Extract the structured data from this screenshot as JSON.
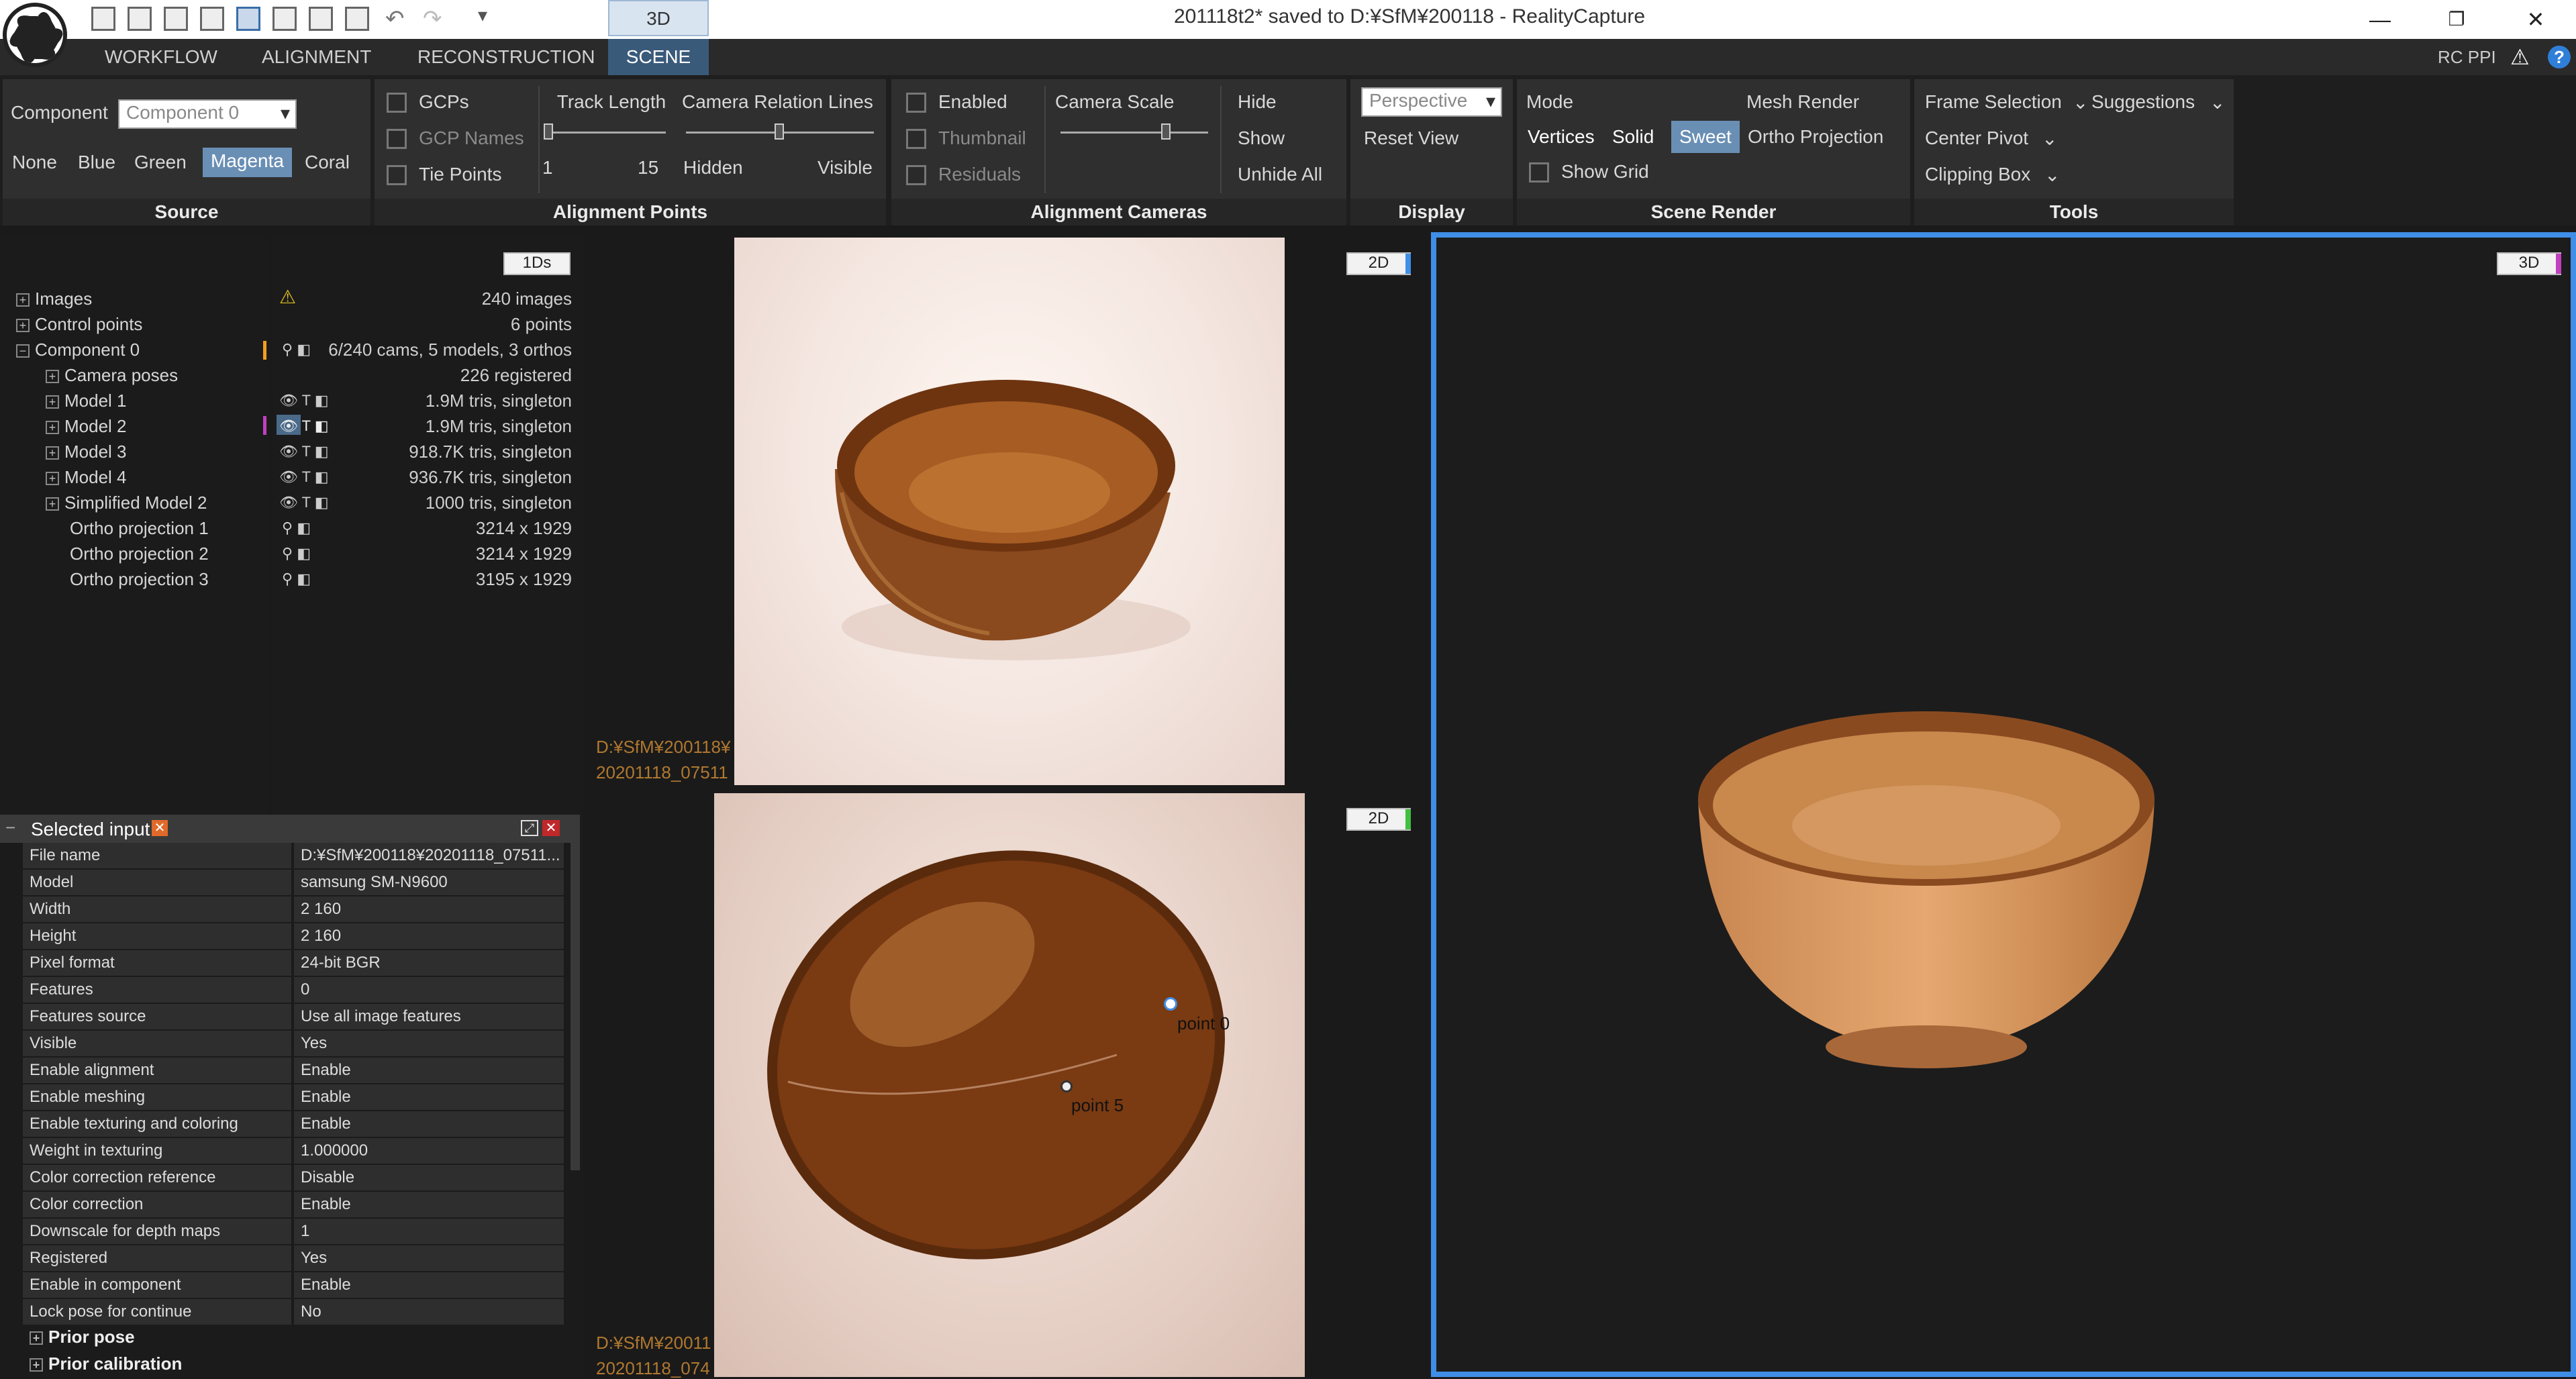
{
  "titlebar": {
    "view_tab": "3D",
    "title": "201118t2* saved to D:¥SfM¥200118 - RealityCapture",
    "minimize": "—",
    "restore": "❐",
    "close": "✕"
  },
  "menu": {
    "tabs": [
      "WORKFLOW",
      "ALIGNMENT",
      "RECONSTRUCTION",
      "SCENE"
    ],
    "right_label": "RC PPI"
  },
  "ribbon": {
    "source": {
      "component_label": "Component",
      "component_value": "Component 0",
      "colors": [
        "None",
        "Blue",
        "Green",
        "Magenta",
        "Coral"
      ],
      "footer": "Source"
    },
    "alignment_points": {
      "gcps": "GCPs",
      "gcp_names": "GCP Names",
      "tie_points": "Tie Points",
      "track_length": "Track Length",
      "track_min": "1",
      "track_max": "15",
      "camera_relation_lines": "Camera Relation Lines",
      "hidden": "Hidden",
      "visible": "Visible",
      "footer": "Alignment Points"
    },
    "alignment_cameras": {
      "enabled": "Enabled",
      "thumbnail": "Thumbnail",
      "residuals": "Residuals",
      "camera_scale": "Camera Scale",
      "hide": "Hide",
      "show": "Show",
      "unhide_all": "Unhide All",
      "footer": "Alignment Cameras"
    },
    "display": {
      "projection": "Perspective",
      "reset_view": "Reset View",
      "footer": "Display"
    },
    "scene_render": {
      "mode": "Mode",
      "mesh_render": "Mesh Render",
      "vertices": "Vertices",
      "solid": "Solid",
      "sweet": "Sweet",
      "ortho_projection": "Ortho Projection",
      "show_grid": "Show Grid",
      "footer": "Scene Render"
    },
    "tools": {
      "frame_selection": "Frame Selection",
      "suggestions": "Suggestions",
      "center_pivot": "Center Pivot",
      "clipping_box": "Clipping Box",
      "footer": "Tools"
    }
  },
  "tree": {
    "badge": "1Ds",
    "rows": [
      {
        "label": "Images",
        "value": "240 images"
      },
      {
        "label": "Control points",
        "value": "6 points"
      },
      {
        "label": "Component 0",
        "value": "6/240 cams, 5 models, 3 orthos"
      },
      {
        "label": "Camera poses",
        "value": "226 registered"
      },
      {
        "label": "Model 1",
        "value": "1.9M tris, singleton"
      },
      {
        "label": "Model 2",
        "value": "1.9M tris, singleton"
      },
      {
        "label": "Model 3",
        "value": "918.7K tris, singleton"
      },
      {
        "label": "Model 4",
        "value": "936.7K tris, singleton"
      },
      {
        "label": "Simplified Model 2",
        "value": "1000 tris, singleton"
      },
      {
        "label": "Ortho projection 1",
        "value": "3214 x 1929"
      },
      {
        "label": "Ortho projection 2",
        "value": "3214 x 1929"
      },
      {
        "label": "Ortho projection 3",
        "value": "3195 x 1929"
      }
    ]
  },
  "selected_input": {
    "title": "Selected input",
    "props": [
      {
        "k": "File name",
        "v": "D:¥SfM¥200118¥20201118_07511..."
      },
      {
        "k": "Model",
        "v": "samsung SM-N9600"
      },
      {
        "k": "Width",
        "v": "2 160"
      },
      {
        "k": "Height",
        "v": "2 160"
      },
      {
        "k": "Pixel format",
        "v": "24-bit BGR"
      },
      {
        "k": "Features",
        "v": "0"
      },
      {
        "k": "Features source",
        "v": "Use all image features"
      },
      {
        "k": "Visible",
        "v": "Yes"
      },
      {
        "k": "Enable alignment",
        "v": "Enable"
      },
      {
        "k": "Enable meshing",
        "v": "Enable"
      },
      {
        "k": "Enable texturing and coloring",
        "v": "Enable"
      },
      {
        "k": "Weight in texturing",
        "v": "1.000000"
      },
      {
        "k": "Color correction reference",
        "v": "Disable"
      },
      {
        "k": "Color correction",
        "v": "Enable"
      },
      {
        "k": "Downscale for depth maps",
        "v": "1"
      },
      {
        "k": "Registered",
        "v": "Yes"
      },
      {
        "k": "Enable in component",
        "v": "Enable"
      },
      {
        "k": "Lock pose for continue",
        "v": "No"
      }
    ],
    "sections": [
      "Prior pose",
      "Prior calibration"
    ]
  },
  "viewers": {
    "top": {
      "badge": "2D",
      "path1": "D:¥SfM¥200118¥",
      "path2": "20201118_07511"
    },
    "bottom": {
      "badge": "2D",
      "path1": "D:¥SfM¥20011",
      "path2": "20201118_074",
      "point0": "point 0",
      "point5": "point 5"
    },
    "right": {
      "badge": "3D"
    }
  },
  "colors": {
    "accent": "#3f8ee8",
    "magenta": "#c040c0",
    "warning": "#e0c020",
    "path": "#b07830"
  }
}
